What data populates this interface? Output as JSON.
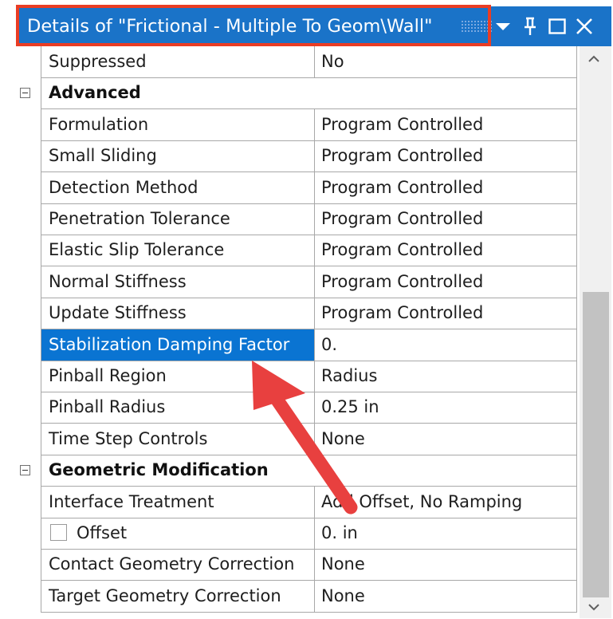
{
  "window": {
    "title": "Details of \"Frictional - Multiple To Geom\\Wall\"",
    "buttons": [
      "pin-dropdown",
      "pin",
      "maximize",
      "close"
    ]
  },
  "rows": [
    {
      "kind": "prop",
      "name": "Suppressed",
      "value": "No"
    },
    {
      "kind": "cat",
      "name": "Advanced"
    },
    {
      "kind": "prop",
      "name": "Formulation",
      "value": "Program Controlled"
    },
    {
      "kind": "prop",
      "name": "Small Sliding",
      "value": "Program Controlled"
    },
    {
      "kind": "prop",
      "name": "Detection Method",
      "value": "Program Controlled"
    },
    {
      "kind": "prop",
      "name": "Penetration Tolerance",
      "value": "Program Controlled"
    },
    {
      "kind": "prop",
      "name": "Elastic Slip Tolerance",
      "value": "Program Controlled"
    },
    {
      "kind": "prop",
      "name": "Normal Stiffness",
      "value": "Program Controlled"
    },
    {
      "kind": "prop",
      "name": "Update Stiffness",
      "value": "Program Controlled"
    },
    {
      "kind": "prop",
      "name": "Stabilization Damping Factor",
      "value": "0.",
      "selected": true
    },
    {
      "kind": "prop",
      "name": "Pinball Region",
      "value": "Radius"
    },
    {
      "kind": "prop",
      "name": "Pinball Radius",
      "value": "0.25 in"
    },
    {
      "kind": "prop",
      "name": "Time Step Controls",
      "value": "None"
    },
    {
      "kind": "cat",
      "name": "Geometric Modification"
    },
    {
      "kind": "prop",
      "name": "Interface Treatment",
      "value": "Add Offset, No Ramping"
    },
    {
      "kind": "prop",
      "name": "Offset",
      "value": "0. in",
      "checkbox": true
    },
    {
      "kind": "prop",
      "name": "Contact Geometry Correction",
      "value": "None"
    },
    {
      "kind": "prop",
      "name": "Target Geometry Correction",
      "value": "None"
    }
  ],
  "colors": {
    "titlebar": "#1a73c8",
    "selection": "#0a74d2",
    "highlight_box": "#ea3d24",
    "annotation_arrow": "#e8403f"
  },
  "annotations": {
    "arrow_icon": "red-arrow-icon",
    "box": "red-highlight-box"
  }
}
